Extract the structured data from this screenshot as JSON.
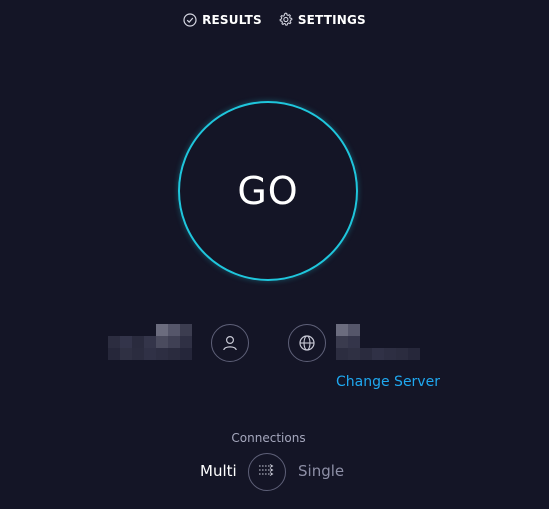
{
  "nav": {
    "results_label": "RESULTS",
    "settings_label": "SETTINGS"
  },
  "go": {
    "label": "GO"
  },
  "provider": {
    "icon": "user-icon",
    "name_redacted": true
  },
  "server": {
    "icon": "globe-icon",
    "name_redacted": true,
    "change_label": "Change Server"
  },
  "connections": {
    "label": "Connections",
    "options": [
      "Multi",
      "Single"
    ],
    "selected": "Multi"
  },
  "colors": {
    "background": "#141526",
    "accent_ring": "#1fc6dc",
    "link": "#1fa8f0"
  }
}
